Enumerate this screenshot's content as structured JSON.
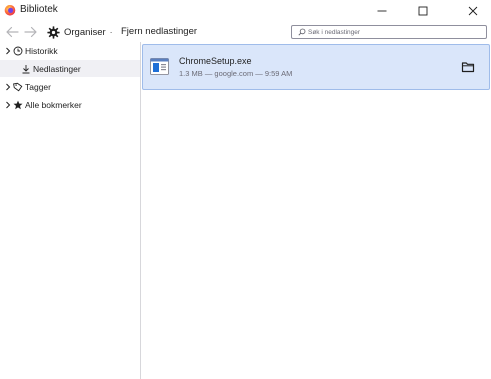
{
  "window": {
    "title": "Bibliotek",
    "controls": [
      "minimize-icon",
      "maximize-icon",
      "close-icon"
    ]
  },
  "toolbar": {
    "organize_label": "Organiser",
    "organize_dot": "·",
    "clear_downloads_label": "Fjern nedlastinger",
    "search_placeholder": "Søk i nedlastinger"
  },
  "sidebar": {
    "items": [
      {
        "label": "Historikk",
        "icon": "clock-icon",
        "expandable": true
      },
      {
        "label": "Nedlastinger",
        "icon": "download-arrow-icon",
        "expandable": false,
        "selected": true
      },
      {
        "label": "Tagger",
        "icon": "tag-icon",
        "expandable": true
      },
      {
        "label": "Alle bokmerker",
        "icon": "star-icon",
        "expandable": true
      }
    ]
  },
  "downloads": [
    {
      "name": "ChromeSetup.exe",
      "details": "1.3 MB — google.com — 9:59 AM",
      "icon": "installer-file-icon",
      "action_icon": "open-folder-icon"
    }
  ],
  "colors": {
    "selected_download_bg": "#dae6fa",
    "selected_download_border": "#9fbcea",
    "sidebar_selected_bg": "#f0f0f4",
    "firefox_orange": "#ff7139"
  }
}
